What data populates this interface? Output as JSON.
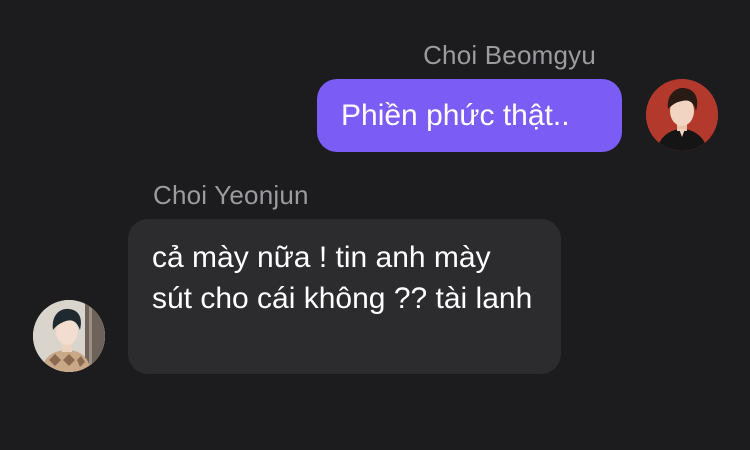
{
  "messages": [
    {
      "sender": "Choi Beomgyu",
      "text": "Phiền phức thật..",
      "direction": "outgoing",
      "avatar_icon": "profile-photo-red-background"
    },
    {
      "sender": "Choi Yeonjun",
      "text": "cả mày nữa ! tin anh mày sút cho cái không ?? tài lanh",
      "direction": "incoming",
      "avatar_icon": "profile-photo-light-background"
    }
  ],
  "colors": {
    "background": "#1c1c1e",
    "outgoing_bubble": "#7b5cf5",
    "incoming_bubble": "#2c2c2e",
    "sender_name": "#9b9ba0",
    "message_text": "#ffffff"
  }
}
